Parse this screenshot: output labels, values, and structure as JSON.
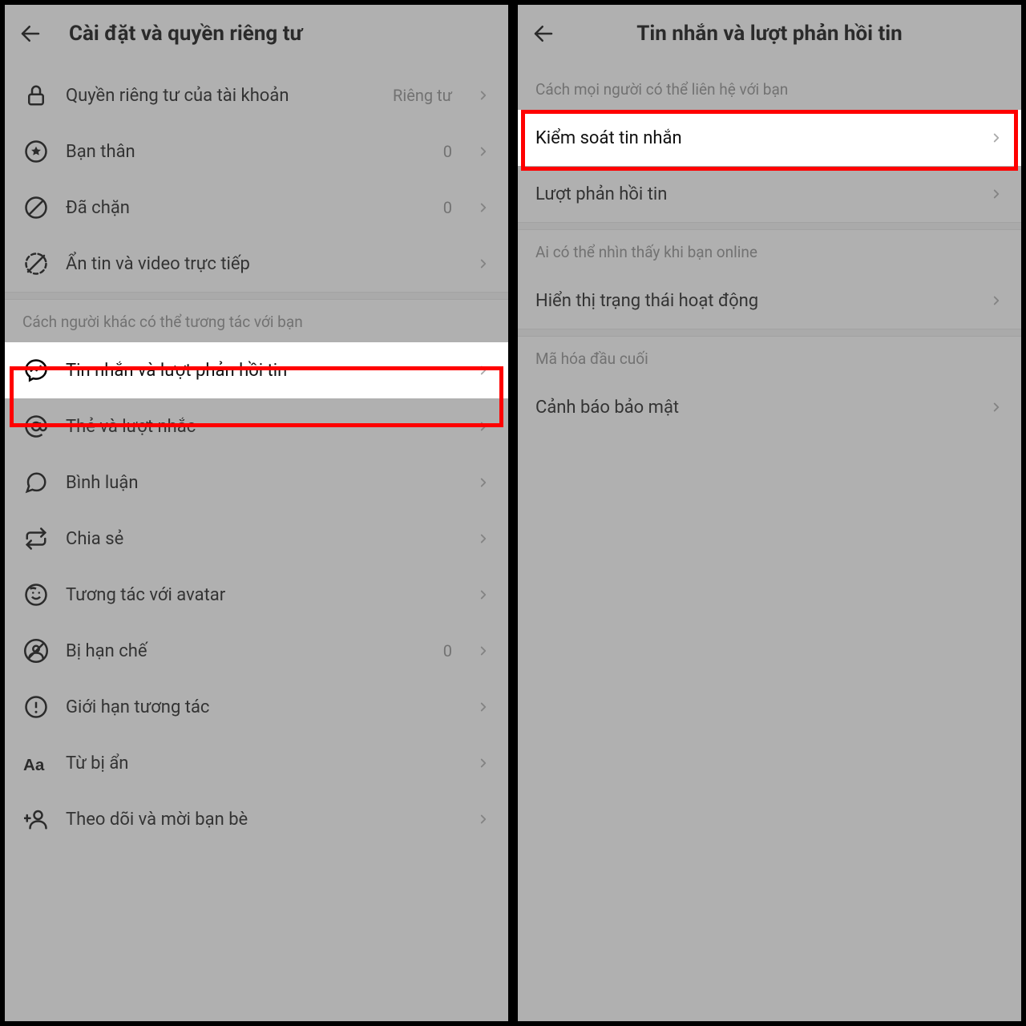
{
  "left": {
    "title": "Cài đặt và quyền riêng tư",
    "rows": [
      {
        "label": "Quyền riêng tư của tài khoản",
        "value": "Riêng tư"
      },
      {
        "label": "Bạn thân",
        "value": "0"
      },
      {
        "label": "Đã chặn",
        "value": "0"
      },
      {
        "label": "Ẩn tin và video trực tiếp",
        "value": ""
      }
    ],
    "section2_header": "Cách người khác có thể tương tác với bạn",
    "rows2": [
      {
        "label": "Tin nhắn và lượt phản hồi tin"
      },
      {
        "label": "Thẻ và lượt nhắc"
      },
      {
        "label": "Bình luận"
      },
      {
        "label": "Chia sẻ"
      },
      {
        "label": "Tương tác với avatar"
      },
      {
        "label": "Bị hạn chế",
        "value": "0"
      },
      {
        "label": "Giới hạn tương tác"
      },
      {
        "label": "Từ bị ẩn"
      },
      {
        "label": "Theo dõi và mời bạn bè"
      }
    ]
  },
  "right": {
    "title": "Tin nhắn và lượt phản hồi tin",
    "section1_header": "Cách mọi người có thể liên hệ với bạn",
    "rows1": [
      {
        "label": "Kiểm soát tin nhắn"
      },
      {
        "label": "Lượt phản hồi tin"
      }
    ],
    "section2_header": "Ai có thể nhìn thấy khi bạn online",
    "rows2": [
      {
        "label": "Hiển thị trạng thái hoạt động"
      }
    ],
    "section3_header": "Mã hóa đầu cuối",
    "rows3": [
      {
        "label": "Cảnh báo bảo mật"
      }
    ]
  }
}
